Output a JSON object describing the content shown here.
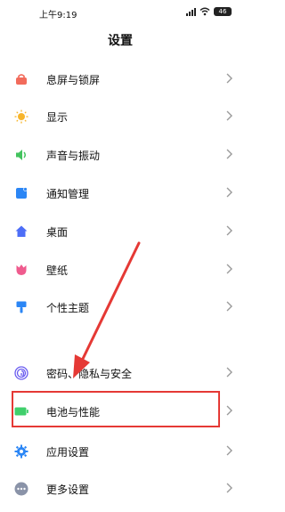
{
  "status_bar": {
    "time": "上午9:19",
    "battery_level": "46"
  },
  "header": {
    "title": "设置"
  },
  "settings": [
    {
      "label": "息屏与锁屏",
      "icon": "lock-screen-icon",
      "color": "#f26b5b"
    },
    {
      "label": "显示",
      "icon": "sun-icon",
      "color": "#f7b52c"
    },
    {
      "label": "声音与振动",
      "icon": "speaker-icon",
      "color": "#43c35e"
    },
    {
      "label": "通知管理",
      "icon": "notification-icon",
      "color": "#2b86f5"
    },
    {
      "label": "桌面",
      "icon": "home-icon",
      "color": "#4d6ef7"
    },
    {
      "label": "壁纸",
      "icon": "tulip-icon",
      "color": "#ef5b8e"
    },
    {
      "label": "个性主题",
      "icon": "paint-roller-icon",
      "color": "#2b86f5"
    },
    {
      "label": "密码、隐私与安全",
      "icon": "fingerprint-icon",
      "color": "#6a5cf0"
    },
    {
      "label": "电池与性能",
      "icon": "battery-icon",
      "color": "#3fcf6b"
    },
    {
      "label": "应用设置",
      "icon": "gear-icon",
      "color": "#2b86f5"
    },
    {
      "label": "更多设置",
      "icon": "more-dots-icon",
      "color": "#8a93a8"
    }
  ],
  "annotation": {
    "highlight_color": "#e53935"
  }
}
